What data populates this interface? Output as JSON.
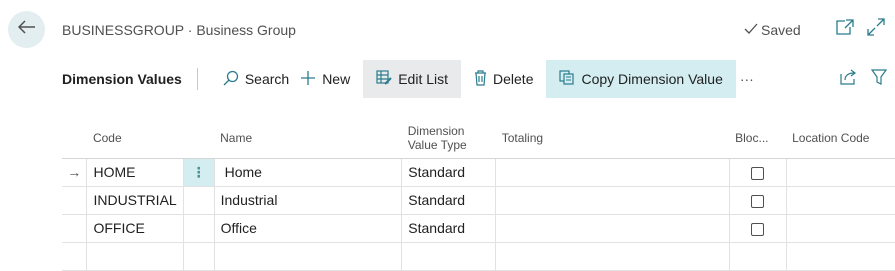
{
  "header": {
    "title": "BUSINESSGROUP · Business Group",
    "saved_label": "Saved"
  },
  "actionbar": {
    "title": "Dimension Values",
    "search_label": "Search",
    "new_label": "New",
    "edit_list_label": "Edit List",
    "delete_label": "Delete",
    "copy_dimension_value_label": "Copy Dimension Value",
    "more_label": "···"
  },
  "grid": {
    "columns": {
      "code": "Code",
      "name": "Name",
      "dim_type_line1": "Dimension",
      "dim_type_line2": "Value Type",
      "totaling": "Totaling",
      "blocked": "Bloc...",
      "location_code": "Location Code"
    },
    "current_row_marker": "→",
    "row_menu_glyph": "⋮",
    "rows": [
      {
        "code": "HOME",
        "name": "Home",
        "type": "Standard",
        "totaling": "",
        "blocked": false,
        "location_code": ""
      },
      {
        "code": "INDUSTRIAL",
        "name": "Industrial",
        "type": "Standard",
        "totaling": "",
        "blocked": false,
        "location_code": ""
      },
      {
        "code": "OFFICE",
        "name": "Office",
        "type": "Standard",
        "totaling": "",
        "blocked": false,
        "location_code": ""
      }
    ]
  },
  "colors": {
    "accent_bg": "#d3edf1",
    "back_button_bg": "#e3eef1",
    "icon_color": "#2a7c8c"
  },
  "icons": [
    "back-arrow-icon",
    "checkmark-icon",
    "open-new-window-icon",
    "expand-icon",
    "search-icon",
    "plus-icon",
    "edit-list-icon",
    "trash-icon",
    "copy-icon",
    "share-icon",
    "filter-icon"
  ]
}
